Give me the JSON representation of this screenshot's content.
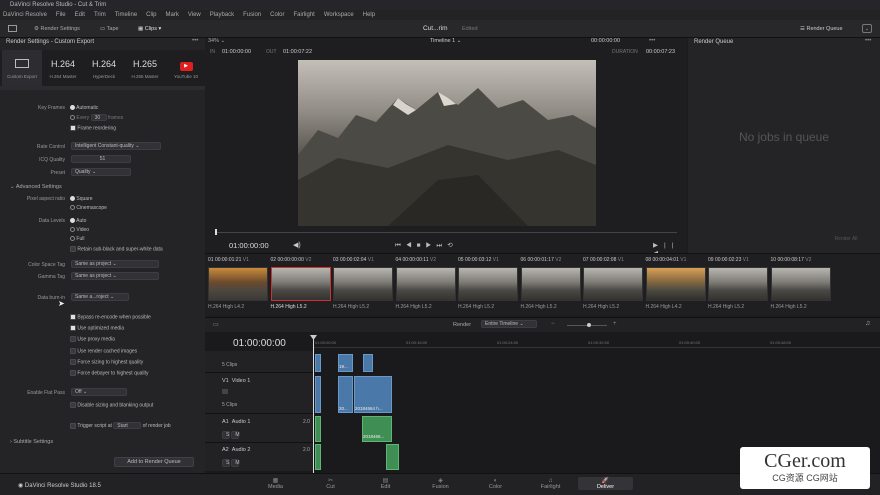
{
  "app": {
    "title": "DaVinci Resolve Studio - Cut & Trim",
    "brand": "DaVinci Resolve Studio 18.5"
  },
  "menu": [
    "DaVinci Resolve",
    "File",
    "Edit",
    "Trim",
    "Timeline",
    "Clip",
    "Mark",
    "View",
    "Playback",
    "Fusion",
    "Color",
    "Fairlight",
    "Workspace",
    "Help"
  ],
  "toolbar": {
    "render_settings": "Render Settings",
    "tape": "Tape",
    "clips": "Clips",
    "project": "Cut...rim",
    "edited": "Edited",
    "render_queue": "Render Queue",
    "zoom": "34%",
    "timeline": "Timeline 1",
    "tc_top": "00:00:00:00"
  },
  "render_settings": {
    "header": "Render Settings - Custom Export",
    "presets": [
      {
        "big": "",
        "small": "Custom Export"
      },
      {
        "big": "H.264",
        "small": "H.264 Master"
      },
      {
        "big": "H.264",
        "small": "HyperDeck"
      },
      {
        "big": "H.265",
        "small": "H.265 Master"
      },
      {
        "big": "",
        "small": "YouTube 10"
      }
    ],
    "key_frames_label": "Key Frames",
    "automatic": "Automatic",
    "every": "Every",
    "every_val": "30",
    "frames": "frames",
    "frame_reordering": "Frame reordering",
    "rate_control_label": "Rate Control",
    "rate_control": "Intelligent Constant-quality",
    "icq_label": "ICQ Quality",
    "icq": "51",
    "preset_label": "Preset",
    "preset": "Quality",
    "advanced": "Advanced Settings",
    "pixel_aspect_label": "Pixel aspect ratio",
    "square": "Square",
    "cinemascope": "Cinemascope",
    "data_levels_label": "Data Levels",
    "auto": "Auto",
    "video": "Video",
    "full": "Full",
    "retain": "Retain sub-black and super-white data",
    "color_space_label": "Color Space Tag",
    "color_space": "Same as project",
    "gamma_label": "Gamma Tag",
    "gamma": "Same as project",
    "burn_label": "Data burn-in",
    "burn": "Same a...roject",
    "bypass": "Bypass re-encode when possible",
    "optimized": "Use optimized media",
    "proxy": "Use proxy media",
    "cached": "Use render cached images",
    "sizing": "Force sizing to highest quality",
    "debayer": "Force debayer to highest quality",
    "flat_label": "Enable Flat Pass",
    "flat": "Off",
    "disable_sizing": "Disable sizing and blanking output",
    "trigger": "Trigger script at",
    "trigger_val": "Start",
    "of_render": "of render job",
    "subtitle": "Subtitle Settings",
    "add_queue": "Add to Render Queue"
  },
  "viewer": {
    "in_label": "IN",
    "in_tc": "01:00:00:00",
    "out_label": "OUT",
    "out_tc": "01:00:07:22",
    "duration_label": "DURATION",
    "duration_tc": "00:00:07:23",
    "playhead_tc": "01:00:00:00"
  },
  "render_queue": {
    "title": "Render Queue",
    "empty": "No jobs in queue",
    "render_all": "Render All"
  },
  "clips": [
    {
      "num": "01",
      "tc": "00:00:01:21",
      "track": "V1",
      "codec": "H.264 High L4.2",
      "style": ""
    },
    {
      "num": "02",
      "tc": "00:00:00:00",
      "track": "V2",
      "codec": "H.264 High L5.2",
      "style": "s2"
    },
    {
      "num": "03",
      "tc": "00:00:02:04",
      "track": "V1",
      "codec": "H.264 High L5.2",
      "style": "s2"
    },
    {
      "num": "04",
      "tc": "00:00:00:11",
      "track": "V2",
      "codec": "H.264 High L5.2",
      "style": "s2"
    },
    {
      "num": "05",
      "tc": "00:00:03:12",
      "track": "V1",
      "codec": "H.264 High L5.2",
      "style": "s2"
    },
    {
      "num": "06",
      "tc": "00:00:01:17",
      "track": "V2",
      "codec": "H.264 High L5.2",
      "style": "s2"
    },
    {
      "num": "07",
      "tc": "00:00:02:08",
      "track": "V1",
      "codec": "H.264 High L5.2",
      "style": "s2"
    },
    {
      "num": "08",
      "tc": "00:00:04:01",
      "track": "V1",
      "codec": "H.264 High L4.2",
      "style": "s3"
    },
    {
      "num": "09",
      "tc": "00:00:02:23",
      "track": "V1",
      "codec": "H.264 High L5.2",
      "style": "s2"
    },
    {
      "num": "10",
      "tc": "00:00:08:17",
      "track": "V2",
      "codec": "H.264 High L5.2",
      "style": "s2"
    }
  ],
  "timeline": {
    "render_label": "Render",
    "render_mode": "Entire Timeline",
    "tc": "01:00:00:00",
    "ruler": [
      "01:00:00:00",
      "01:00:16:00",
      "01:00:24:00",
      "01:00:32:00",
      "01:00:40:00",
      "01:00:48:00"
    ],
    "v2_clips": "5 Clips",
    "v1_name": "Video 1",
    "v1_clips": "5 Clips",
    "v1_track": "V1",
    "a1_track": "A1",
    "a1_name": "Audio 1",
    "a1_ch": "2.0",
    "a2_track": "A2",
    "a2_name": "Audio 2",
    "a2_ch": "2.0",
    "clip_label_a": "19...",
    "clip_label_b": "20...",
    "clip_label_c": "20184664 h...",
    "clip_label_d": "2018466..."
  },
  "pages": [
    "Media",
    "Cut",
    "Edit",
    "Fusion",
    "Color",
    "Fairlight",
    "Deliver"
  ],
  "watermark": {
    "big": "CGer.com",
    "small": "CG资源 CG网站"
  }
}
